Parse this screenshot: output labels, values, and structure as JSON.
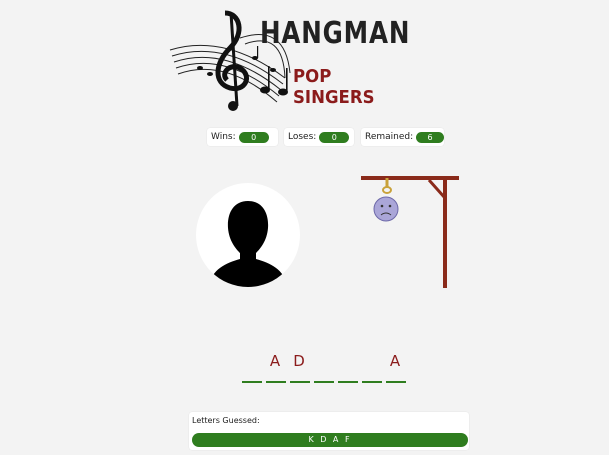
{
  "logo": {
    "title": "HANGMAN",
    "subtitle": "POP SINGERS"
  },
  "stats": [
    {
      "label": "Wins:",
      "value": "0"
    },
    {
      "label": "Loses:",
      "value": "0"
    },
    {
      "label": "Remained:",
      "value": "6"
    }
  ],
  "word": {
    "letters": [
      "",
      "A",
      "D",
      "",
      "",
      "",
      "A"
    ]
  },
  "guessed": {
    "label": "Letters Guessed:",
    "letters": "K D A F"
  },
  "colors": {
    "accent_green": "#2f7d1f",
    "letter_red": "#8b1b1b",
    "gallows_brown": "#8a2a1a"
  },
  "icons": {
    "logo": "music-notes-treble-clef-icon",
    "avatar": "person-silhouette-icon",
    "gallows": "gallows-sad-face-icon"
  }
}
